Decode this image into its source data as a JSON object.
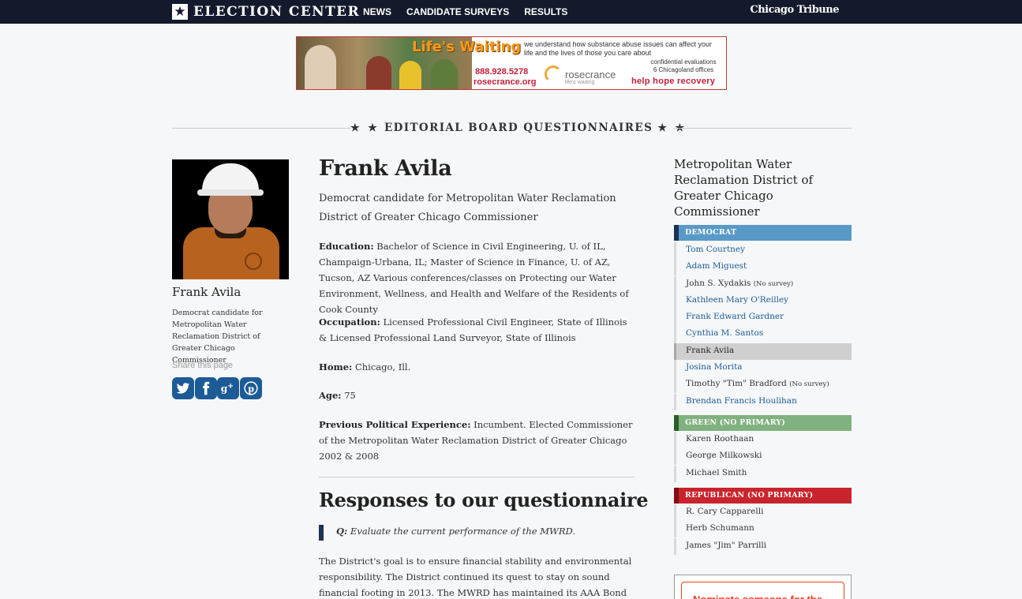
{
  "header": {
    "brand_star": "★",
    "brand_title": "ELECTION CENTER",
    "nav": [
      "NEWS",
      "CANDIDATE SURVEYS",
      "RESULTS"
    ],
    "publisher": "Chicago Tribune"
  },
  "ad": {
    "headline": "Life's Waiting",
    "phone": "888.928.5278",
    "url": "rosecrance.org",
    "logo": "rosecrance",
    "logo_tag": "life's waiting",
    "description": "we understand how substance abuse issues can affect your life and the lives of those you care about",
    "conf_line1": "confidential evaluations",
    "conf_line2": "6 Chicagoland offices",
    "tagline": "help  hope  recovery"
  },
  "section": {
    "stars_left": "★ ★",
    "title": "EDITORIAL BOARD QUESTIONNAIRES",
    "stars_right": "★ ★"
  },
  "sidebar_left": {
    "name": "Frank Avila",
    "description": "Democrat candidate for Metropolitan Water Reclamation District of Greater Chicago Commissioner",
    "share_label": "Share this page",
    "share_icons": [
      "twitter-icon",
      "facebook-icon",
      "google-plus-icon",
      "pinterest-icon"
    ]
  },
  "candidate": {
    "name": "Frank Avila",
    "subtitle": "Democrat candidate for Metropolitan Water Reclamation District of Greater Chicago Commissioner",
    "education_label": "Education:",
    "education": "Bachelor of Science in Civil Engineering, U. of IL, Champaign-Urbana, IL; Master of Science in Finance, U. of AZ, Tucson, AZ Various conferences/classes on Protecting our Water Environment, Wellness, and Health and Welfare of the Residents of Cook County",
    "occupation_label": "Occupation:",
    "occupation": "Licensed Professional Civil Engineer, State of Illinois & Licensed Professional Land Surveyor, State of Illinois",
    "home_label": "Home:",
    "home": "Chicago, Ill.",
    "age_label": "Age:",
    "age": "75",
    "political_label": "Previous Political Experience:",
    "political": "Incumbent. Elected Commissioner of the Metropolitan Water Reclamation District of Greater Chicago 2002 & 2008"
  },
  "responses": {
    "title": "Responses to our questionnaire",
    "q_label": "Q:",
    "question": "Evaluate the current performance of the MWRD.",
    "answer": "The District's goal is to ensure financial stability and environmental responsibility. The District continued its quest to stay on sound financial footing in 2013. The MWRD has maintained its AAA Bond Ratings from"
  },
  "sidebar_right": {
    "race_title": "Metropolitan Water Reclamation District of Greater Chicago Commissioner",
    "democrat_label": "DEMOCRAT",
    "democrats": [
      {
        "name": "Tom Courtney",
        "note": ""
      },
      {
        "name": "Adam Miguest",
        "note": ""
      },
      {
        "name": "John S. Xydakis",
        "note": "(No survey)"
      },
      {
        "name": "Kathleen Mary O'Reilley",
        "note": ""
      },
      {
        "name": "Frank Edward Gardner",
        "note": ""
      },
      {
        "name": "Cynthia M. Santos",
        "note": ""
      },
      {
        "name": "Frank Avila",
        "note": ""
      },
      {
        "name": "Josina Morita",
        "note": ""
      },
      {
        "name": "Timothy \"Tim\" Bradford",
        "note": "(No survey)"
      },
      {
        "name": "Brendan Francis Houlihan",
        "note": ""
      }
    ],
    "green_label": "GREEN",
    "green_note": "(NO PRIMARY)",
    "greens": [
      "Karen Roothaan",
      "George Milkowski",
      "Michael Smith"
    ],
    "republican_label": "REPUBLICAN",
    "republican_note": "(NO PRIMARY)",
    "republicans": [
      "R. Cary Capparelli",
      "Herb Schumann",
      "James \"Jim\" Parrilli"
    ],
    "nominate_button": "Nominate someone for the"
  },
  "colors": {
    "topbar": "#141a2c",
    "democrat": "#5999c7",
    "green": "#80b27f",
    "republican": "#c9242d",
    "link": "#1c5b96"
  }
}
